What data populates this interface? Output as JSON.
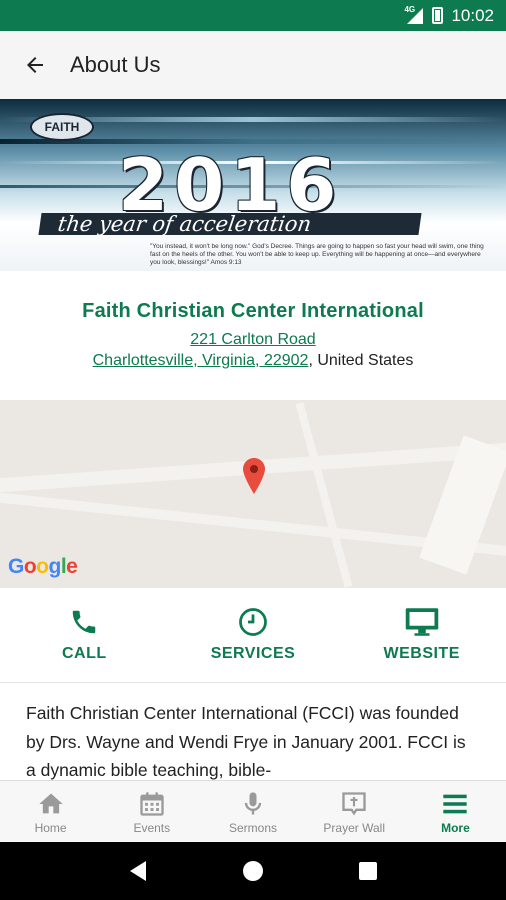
{
  "status_bar": {
    "network": "4G",
    "time": "10:02"
  },
  "app_bar": {
    "title": "About Us"
  },
  "hero": {
    "logo_text": "FAITH",
    "year": "2016",
    "tagline": "the year of acceleration",
    "verse": "\"You instead, it won't be long now.\" God's Decree. Things are going to happen so fast your head will swim, one thing fast on the heels of the other. You won't be able to keep up. Everything will be happening at once—and everywhere you look, blessings!\" Amos 9:13"
  },
  "church": {
    "name": "Faith Christian Center International",
    "street": "221 Carlton Road",
    "city_line": "Charlottesville, Virginia, 22902",
    "country": ", United States"
  },
  "map": {
    "provider": "Google"
  },
  "actions": [
    {
      "label": "CALL",
      "icon": "phone-icon"
    },
    {
      "label": "SERVICES",
      "icon": "clock-icon"
    },
    {
      "label": "WEBSITE",
      "icon": "monitor-icon"
    }
  ],
  "about_text": "Faith Christian Center International (FCCI) was founded by Drs. Wayne and Wendi Frye in January 2001. FCCI is a dynamic bible teaching, bible-",
  "bottom_nav": [
    {
      "label": "Home",
      "icon": "home-icon",
      "active": false
    },
    {
      "label": "Events",
      "icon": "calendar-icon",
      "active": false
    },
    {
      "label": "Sermons",
      "icon": "microphone-icon",
      "active": false
    },
    {
      "label": "Prayer Wall",
      "icon": "prayer-icon",
      "active": false
    },
    {
      "label": "More",
      "icon": "menu-icon",
      "active": true
    }
  ],
  "colors": {
    "primary": "#0d7a4f",
    "inactive": "#9a9a9a"
  }
}
